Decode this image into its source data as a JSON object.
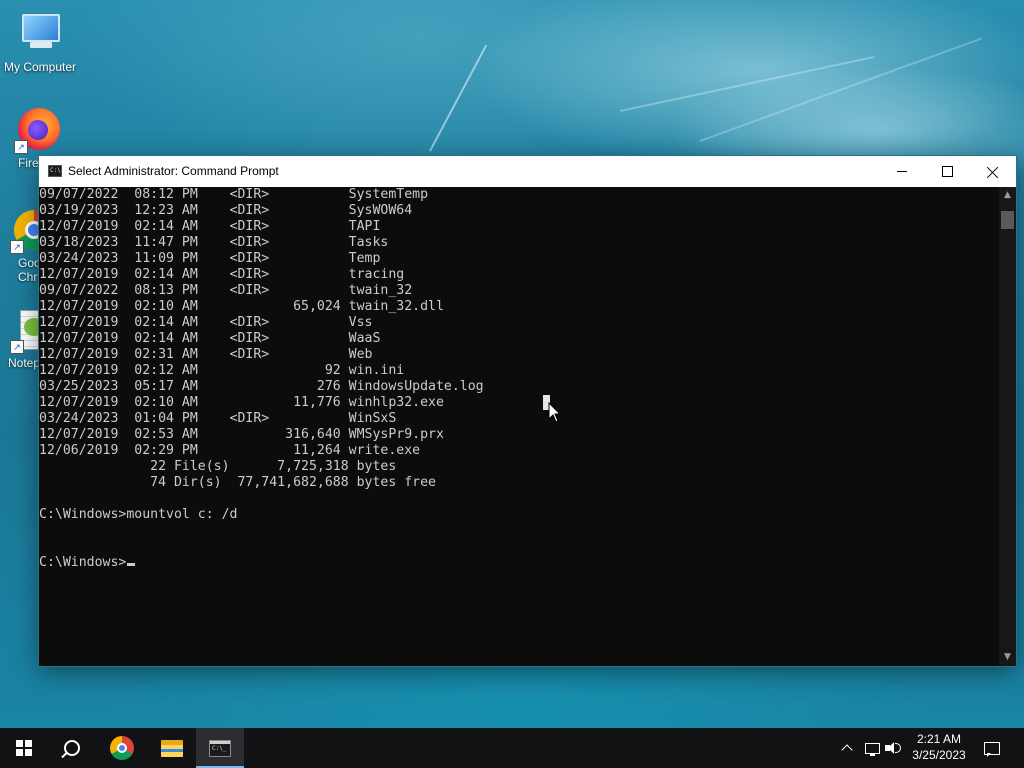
{
  "desktop": {
    "icons": [
      {
        "label": "My Computer",
        "icon": "computer-icon"
      },
      {
        "label": "Fire",
        "icon": "firefox-icon"
      },
      {
        "label": "Goo Chr",
        "icon": "google-chrome-icon",
        "line1": "Goo",
        "line2": "Chr"
      },
      {
        "label": "Notep",
        "icon": "notepad-icon"
      }
    ]
  },
  "window": {
    "title": "Select Administrator:  Command Prompt",
    "icon": "command-prompt-icon",
    "minimize": "minimize",
    "maximize": "maximize",
    "close": "close"
  },
  "console": {
    "lines": [
      "09/07/2022  08:12 PM    <DIR>          SystemTemp",
      "03/19/2023  12:23 AM    <DIR>          SysWOW64",
      "12/07/2019  02:14 AM    <DIR>          TAPI",
      "03/18/2023  11:47 PM    <DIR>          Tasks",
      "03/24/2023  11:09 PM    <DIR>          Temp",
      "12/07/2019  02:14 AM    <DIR>          tracing",
      "09/07/2022  08:13 PM    <DIR>          twain_32",
      "12/07/2019  02:10 AM            65,024 twain_32.dll",
      "12/07/2019  02:14 AM    <DIR>          Vss",
      "12/07/2019  02:14 AM    <DIR>          WaaS",
      "12/07/2019  02:31 AM    <DIR>          Web",
      "12/07/2019  02:12 AM                92 win.ini",
      "03/25/2023  05:17 AM               276 WindowsUpdate.log",
      "12/07/2019  02:10 AM            11,776 winhlp32.exe",
      "03/24/2023  01:04 PM    <DIR>          WinSxS",
      "12/07/2019  02:53 AM           316,640 WMSysPr9.prx",
      "12/06/2019  02:29 PM            11,264 write.exe",
      "              22 File(s)      7,725,318 bytes",
      "              74 Dir(s)  77,741,682,688 bytes free",
      "",
      "C:\\Windows>mountvol c: /d",
      "",
      "",
      "C:\\Windows>"
    ]
  },
  "taskbar": {
    "start": "start-icon",
    "search": "search-icon",
    "apps": [
      "google-chrome-icon",
      "file-explorer-icon",
      "command-prompt-icon"
    ],
    "tray": {
      "chevron": "chevron-up-icon",
      "network": "network-icon",
      "volume": "volume-icon",
      "notifications": "notifications-icon"
    },
    "clock": {
      "time": "2:21 AM",
      "date": "3/25/2023"
    }
  }
}
